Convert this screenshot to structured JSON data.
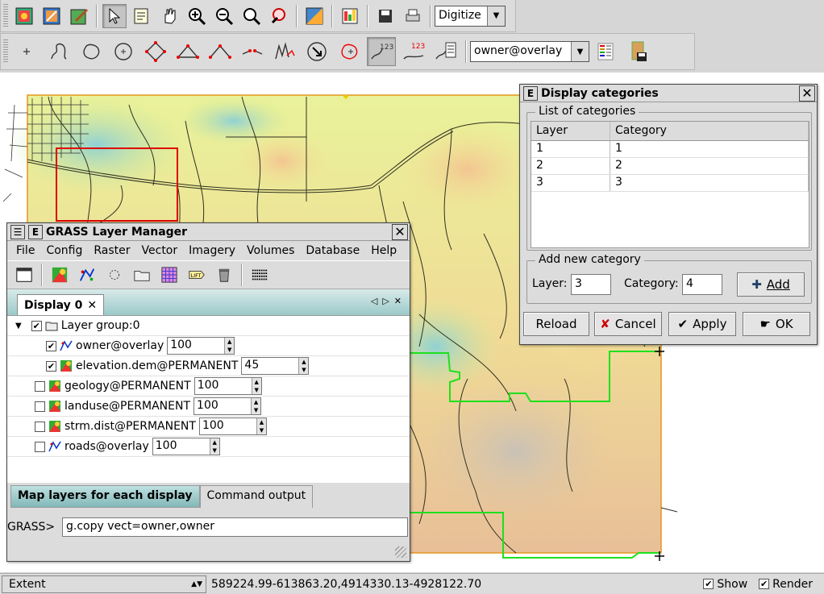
{
  "toolbar1": {
    "mode_select": "Digitize"
  },
  "toolbar2": {
    "layer_select": "owner@overlay"
  },
  "display_categories": {
    "title": "Display categories",
    "list_group_label": "List of categories",
    "columns": [
      "Layer",
      "Category"
    ],
    "rows": [
      [
        "1",
        "1"
      ],
      [
        "2",
        "2"
      ],
      [
        "3",
        "3"
      ]
    ],
    "add_group_label": "Add new category",
    "layer_label": "Layer:",
    "layer_value": "3",
    "category_label": "Category:",
    "category_value": "4",
    "add_button": "Add",
    "reload_button": "Reload",
    "cancel_button": "Cancel",
    "apply_button": "Apply",
    "ok_button": "OK"
  },
  "layer_manager": {
    "title": "GRASS Layer Manager",
    "menu": [
      "File",
      "Config",
      "Raster",
      "Vector",
      "Imagery",
      "Volumes",
      "Database",
      "Help"
    ],
    "display_tab": "Display 0",
    "tree": [
      {
        "name": "Layer group:0",
        "checked": true,
        "level": 0,
        "type": "group"
      },
      {
        "name": "owner@overlay",
        "checked": true,
        "level": 1,
        "type": "vector",
        "opacity": "100"
      },
      {
        "name": "elevation.dem@PERMANENT",
        "checked": true,
        "level": 1,
        "type": "raster",
        "opacity": "45"
      },
      {
        "name": "geology@PERMANENT",
        "checked": false,
        "level": 0,
        "type": "raster",
        "opacity": "100"
      },
      {
        "name": "landuse@PERMANENT",
        "checked": false,
        "level": 0,
        "type": "raster",
        "opacity": "100"
      },
      {
        "name": "strm.dist@PERMANENT",
        "checked": false,
        "level": 0,
        "type": "raster",
        "opacity": "100"
      },
      {
        "name": "roads@overlay",
        "checked": false,
        "level": 0,
        "type": "vector",
        "opacity": "100"
      }
    ],
    "bottom_tabs": [
      "Map layers for each display",
      "Command output"
    ],
    "prompt": "GRASS>",
    "command": "g.copy vect=owner,owner"
  },
  "status": {
    "mode": "Extent",
    "coords": "589224.99-613863.20,4914330.13-4928122.70",
    "show_label": "Show",
    "render_label": "Render"
  }
}
